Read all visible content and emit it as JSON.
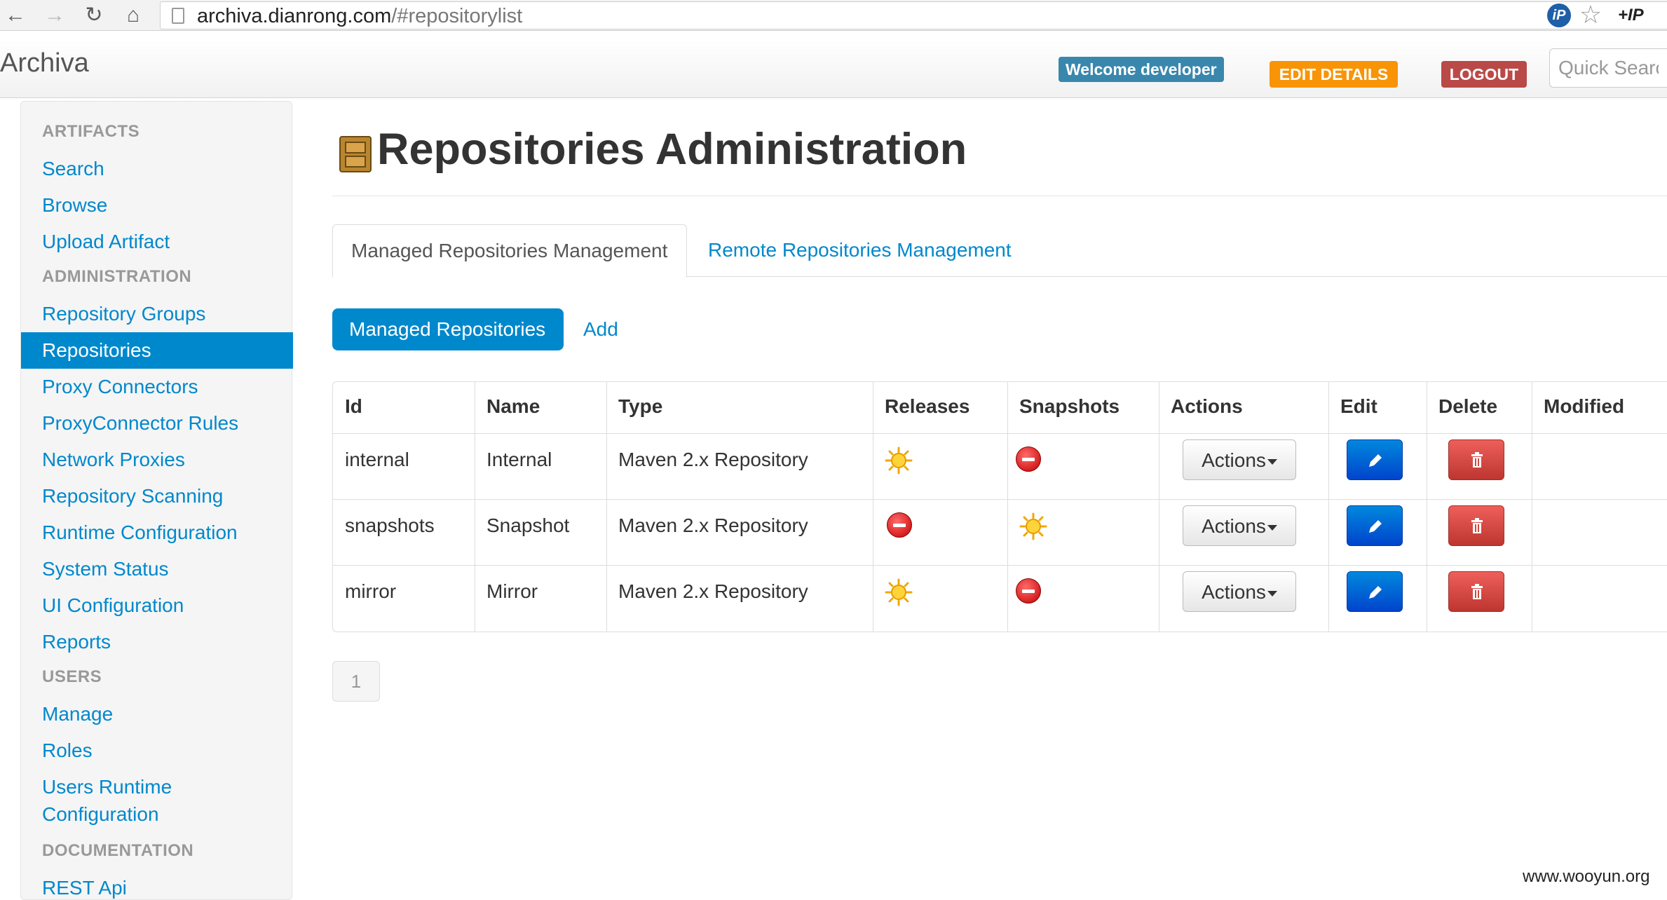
{
  "browser": {
    "url_host": "archiva.dianrong.com",
    "url_path": "/#repositorylist",
    "ext_badge": "iP",
    "ext_label": "+IP"
  },
  "header": {
    "brand": "Archiva",
    "welcome": "Welcome developer",
    "edit_details": "EDIT DETAILS",
    "logout": "LOGOUT",
    "search_placeholder": "Quick Search"
  },
  "sidebar": {
    "sections": [
      {
        "header": "ARTIFACTS",
        "items": [
          "Search",
          "Browse",
          "Upload Artifact"
        ]
      },
      {
        "header": "ADMINISTRATION",
        "items": [
          "Repository Groups",
          "Repositories",
          "Proxy Connectors",
          "ProxyConnector Rules",
          "Network Proxies",
          "Repository Scanning",
          "Runtime Configuration",
          "System Status",
          "UI Configuration",
          "Reports"
        ]
      },
      {
        "header": "USERS",
        "items": [
          "Manage",
          "Roles",
          "Users Runtime",
          "Configuration"
        ]
      },
      {
        "header": "DOCUMENTATION",
        "items": [
          "REST Api"
        ]
      }
    ],
    "active_item": "Repositories"
  },
  "main": {
    "title": "Repositories Administration",
    "tabs": [
      "Managed Repositories Management",
      "Remote Repositories Management"
    ],
    "pills": [
      "Managed Repositories",
      "Add"
    ],
    "table": {
      "columns": [
        "Id",
        "Name",
        "Type",
        "Releases",
        "Snapshots",
        "Actions",
        "Edit",
        "Delete",
        "Modified"
      ],
      "rows": [
        {
          "id": "internal",
          "name": "Internal",
          "type": "Maven 2.x Repository",
          "releases": true,
          "snapshots": false,
          "actions_label": "Actions"
        },
        {
          "id": "snapshots",
          "name": "Snapshot",
          "type": "Maven 2.x Repository",
          "releases": false,
          "snapshots": true,
          "actions_label": "Actions"
        },
        {
          "id": "mirror",
          "name": "Mirror",
          "type": "Maven 2.x Repository",
          "releases": true,
          "snapshots": false,
          "actions_label": "Actions"
        }
      ]
    },
    "pagination": [
      "1"
    ]
  },
  "watermark": "www.wooyun.org",
  "colors": {
    "link": "#0088cc",
    "welcome_badge": "#3a87ad",
    "edit_badge": "#f89406",
    "logout_badge": "#b94a48",
    "edit_button": "#0044cc",
    "delete_button": "#bd362f"
  }
}
